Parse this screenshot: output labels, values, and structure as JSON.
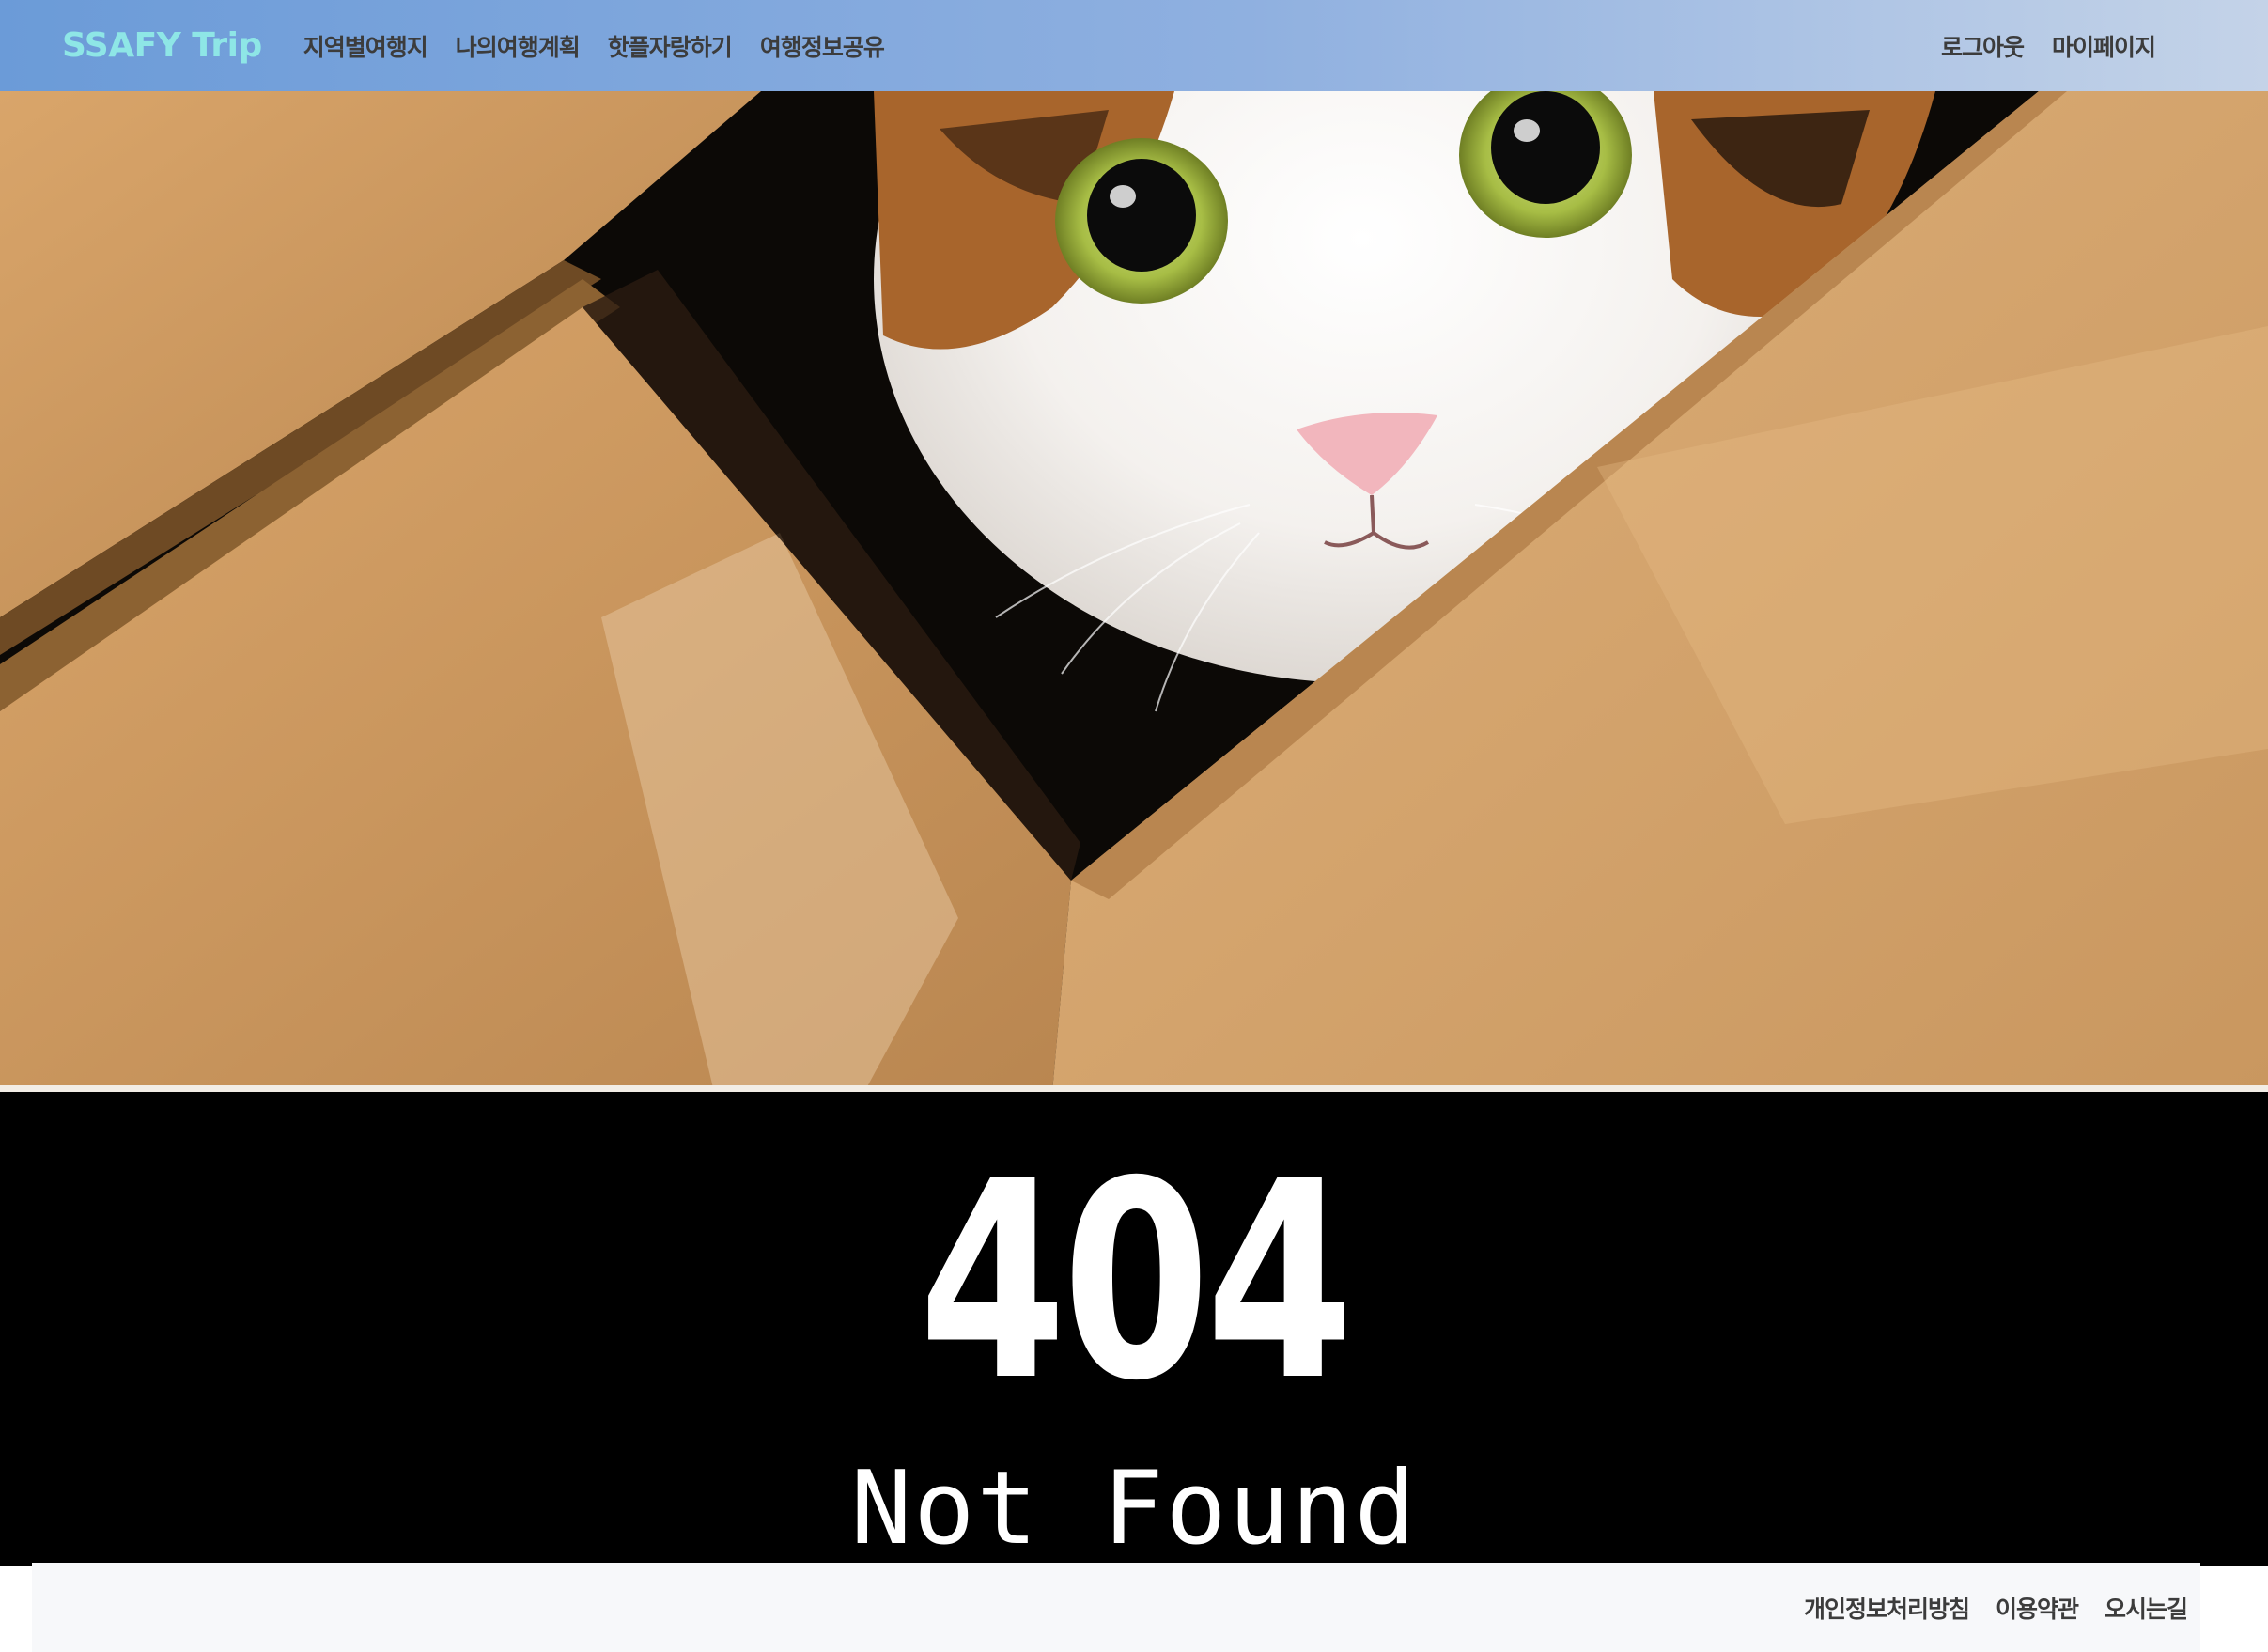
{
  "navbar": {
    "brand": "SSAFY Trip",
    "left_links": [
      {
        "label": "지역별여행지"
      },
      {
        "label": "나의여행계획"
      },
      {
        "label": "핫플자랑하기"
      },
      {
        "label": "여행정보공유"
      }
    ],
    "right_links": [
      {
        "label": "로그아웃"
      },
      {
        "label": "마이페이지"
      }
    ]
  },
  "error": {
    "code": "404",
    "message": "Not Found"
  },
  "footer": {
    "links": [
      {
        "label": "개인정보처리방침"
      },
      {
        "label": "이용약관"
      },
      {
        "label": "오시는길"
      }
    ]
  },
  "colors": {
    "navbar_gradient_start": "#6b9bd8",
    "navbar_gradient_end": "#c4d3e8",
    "brand": "#8ee6e6",
    "nav_text": "#3c3c3c",
    "error_bg": "#000000",
    "error_text": "#ffffff",
    "footer_bg": "#f7f8fa"
  }
}
